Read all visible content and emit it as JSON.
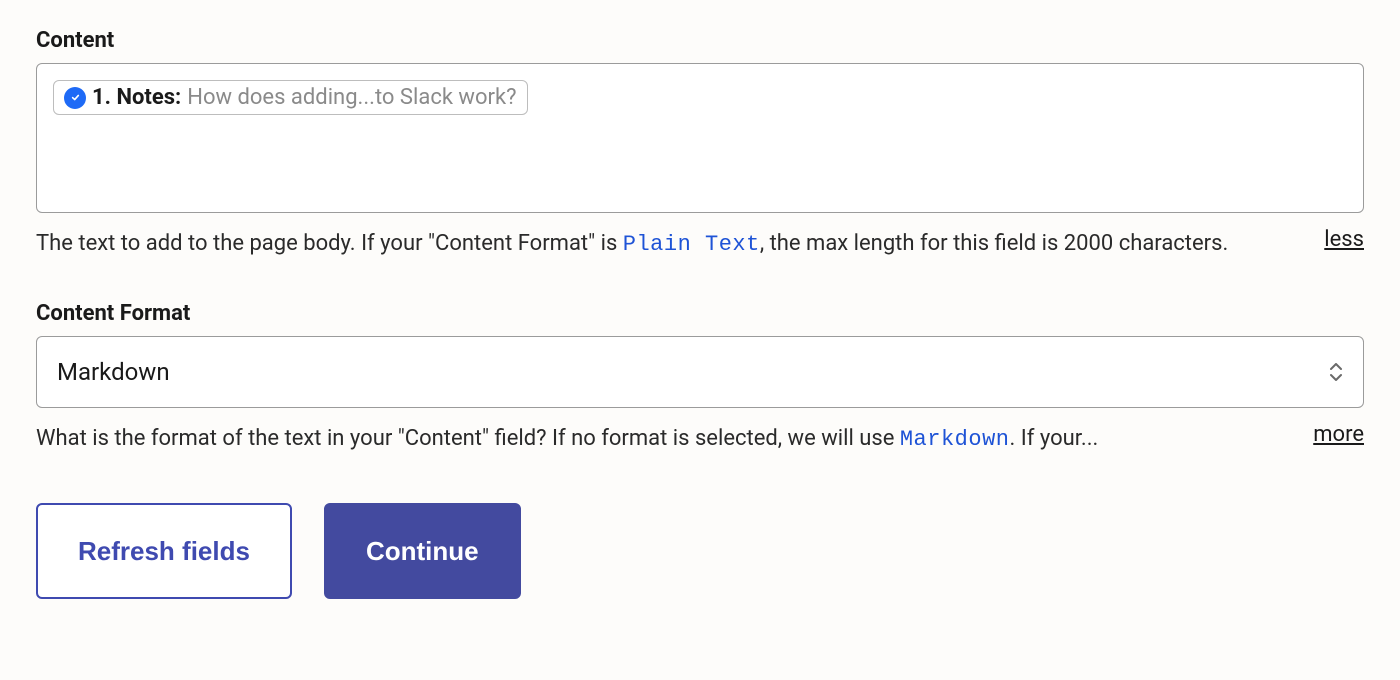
{
  "content": {
    "label": "Content",
    "pill_prefix": "1. Notes:",
    "pill_value": "How does adding...to Slack work?",
    "help_before": "The text to add to the page body. If your \"Content Format\" is ",
    "help_code": "Plain Text",
    "help_after": ", the max length for this field is 2000 characters.",
    "toggle": "less"
  },
  "contentFormat": {
    "label": "Content Format",
    "selected": "Markdown",
    "help_before": "What is the format of the text in your \"Content\" field? If no format is selected, we will use ",
    "help_code": "Markdown",
    "help_after": ". If your...",
    "toggle": "more"
  },
  "buttons": {
    "refresh": "Refresh fields",
    "continue": "Continue"
  }
}
